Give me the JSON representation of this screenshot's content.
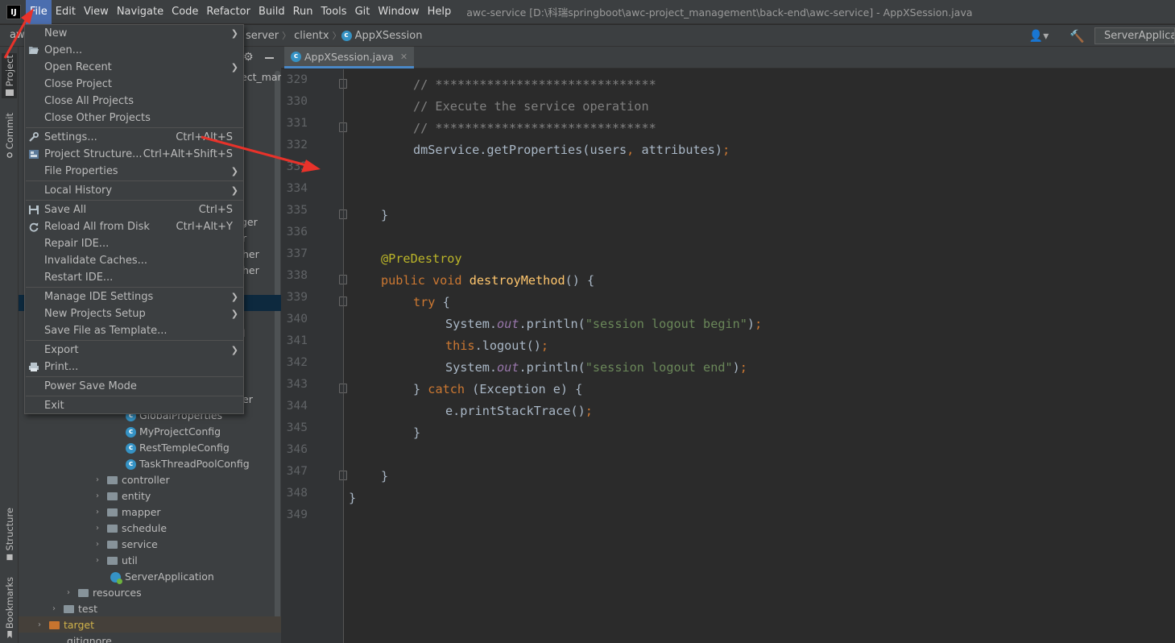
{
  "menubar": {
    "logo": "IJ",
    "items": [
      "File",
      "Edit",
      "View",
      "Navigate",
      "Code",
      "Refactor",
      "Build",
      "Run",
      "Tools",
      "Git",
      "Window",
      "Help"
    ],
    "window_title": "awc-service [D:\\科瑞springboot\\awc-project_management\\back-end\\awc-service] - AppXSession.java"
  },
  "navbar": {
    "crumb_start": "aw",
    "crumbs": [
      "server",
      "clientx",
      "AppXSession"
    ],
    "run_config": "ServerApplication"
  },
  "tool_stripe": {
    "project": "Project",
    "commit": "Commit",
    "structure": "Structure",
    "bookmarks": "Bookmarks"
  },
  "project_panel": {
    "fragments": [
      "ect_mar",
      "ger",
      "r",
      "her",
      "her",
      "l",
      "er"
    ],
    "tree": [
      {
        "label": "GlobalProperties",
        "kind": "class"
      },
      {
        "label": "MyProjectConfig",
        "kind": "class"
      },
      {
        "label": "RestTempleConfig",
        "kind": "class"
      },
      {
        "label": "TaskThreadPoolConfig",
        "kind": "class"
      },
      {
        "label": "controller",
        "kind": "folder"
      },
      {
        "label": "entity",
        "kind": "folder"
      },
      {
        "label": "mapper",
        "kind": "folder"
      },
      {
        "label": "schedule",
        "kind": "folder"
      },
      {
        "label": "service",
        "kind": "folder"
      },
      {
        "label": "util",
        "kind": "folder"
      },
      {
        "label": "ServerApplication",
        "kind": "app"
      },
      {
        "label": "resources",
        "kind": "folder"
      },
      {
        "label": "test",
        "kind": "folder"
      },
      {
        "label": "target",
        "kind": "folder"
      },
      {
        "label": ".gitignore",
        "kind": "file"
      }
    ]
  },
  "editor": {
    "tab": "AppXSession.java",
    "line_numbers": [
      "329",
      "330",
      "331",
      "332",
      "333",
      "334",
      "335",
      "336",
      "337",
      "338",
      "339",
      "340",
      "341",
      "342",
      "343",
      "344",
      "345",
      "346",
      "347",
      "348",
      "349"
    ],
    "code": {
      "l329": "// ******************************",
      "l330": "// Execute the service operation",
      "l331": "// ******************************",
      "l332a": "dmService.getProperties(users",
      "l332b": ", ",
      "l332c": "attributes)",
      "l332d": ";",
      "l335": "}",
      "l337": "@PreDestroy",
      "l338a": "public void ",
      "l338b": "destroyMethod",
      "l338c": "() {",
      "l339a": "try ",
      "l339b": "{",
      "l340a": "System.",
      "l340b": "out",
      "l340c": ".println(",
      "l340d": "\"session logout begin\"",
      "l340e": ")",
      "l340f": ";",
      "l341a": "this",
      "l341b": ".logout()",
      "l341c": ";",
      "l342a": "System.",
      "l342b": "out",
      "l342c": ".println(",
      "l342d": "\"session logout end\"",
      "l342e": ")",
      "l342f": ";",
      "l343a": "} ",
      "l343b": "catch ",
      "l343c": "(Exception e) {",
      "l344a": "e.printStackTrace()",
      "l344b": ";",
      "l345": "}",
      "l347": "}",
      "l348": "}"
    }
  },
  "file_menu": {
    "items": [
      {
        "label": "New",
        "shortcut": "",
        "submenu": true
      },
      {
        "label": "Open...",
        "shortcut": "",
        "submenu": false
      },
      {
        "label": "Open Recent",
        "shortcut": "",
        "submenu": true
      },
      {
        "label": "Close Project",
        "shortcut": "",
        "submenu": false
      },
      {
        "label": "Close All Projects",
        "shortcut": "",
        "submenu": false
      },
      {
        "label": "Close Other Projects",
        "shortcut": "",
        "submenu": false
      },
      {
        "label": "Settings...",
        "shortcut": "Ctrl+Alt+S",
        "submenu": false
      },
      {
        "label": "Project Structure...",
        "shortcut": "Ctrl+Alt+Shift+S",
        "submenu": false
      },
      {
        "label": "File Properties",
        "shortcut": "",
        "submenu": true
      },
      {
        "label": "Local History",
        "shortcut": "",
        "submenu": true
      },
      {
        "label": "Save All",
        "shortcut": "Ctrl+S",
        "submenu": false
      },
      {
        "label": "Reload All from Disk",
        "shortcut": "Ctrl+Alt+Y",
        "submenu": false
      },
      {
        "label": "Repair IDE...",
        "shortcut": "",
        "submenu": false
      },
      {
        "label": "Invalidate Caches...",
        "shortcut": "",
        "submenu": false
      },
      {
        "label": "Restart IDE...",
        "shortcut": "",
        "submenu": false
      },
      {
        "label": "Manage IDE Settings",
        "shortcut": "",
        "submenu": true
      },
      {
        "label": "New Projects Setup",
        "shortcut": "",
        "submenu": true
      },
      {
        "label": "Save File as Template...",
        "shortcut": "",
        "submenu": false
      },
      {
        "label": "Export",
        "shortcut": "",
        "submenu": true
      },
      {
        "label": "Print...",
        "shortcut": "",
        "submenu": false
      },
      {
        "label": "Power Save Mode",
        "shortcut": "",
        "submenu": false
      },
      {
        "label": "Exit",
        "shortcut": "",
        "submenu": false
      }
    ]
  },
  "colors": {
    "accent": "#4b6eaf",
    "annotation_arrow": "#e8322a",
    "folder_target": "#c7742f"
  }
}
